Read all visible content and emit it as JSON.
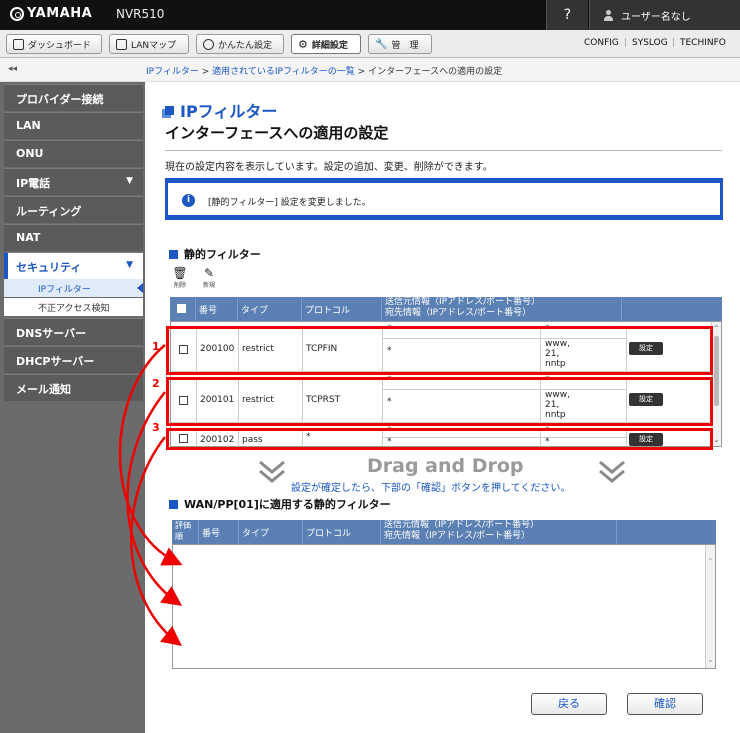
{
  "header": {
    "brand": "YAMAHA",
    "model": "NVR510",
    "help": "?",
    "user": "ユーザー名なし"
  },
  "toolbar": {
    "tabs": [
      {
        "label": "ダッシュボード",
        "icon": "dashboard-icon"
      },
      {
        "label": "LANマップ",
        "icon": "lan-map-icon"
      },
      {
        "label": "かんたん設定",
        "icon": "wizard-icon"
      },
      {
        "label": "詳細設定",
        "icon": "gear-icon",
        "active": true
      },
      {
        "label": "管　理",
        "icon": "wrench-icon"
      }
    ],
    "links": [
      "CONFIG",
      "SYSLOG",
      "TECHINFO"
    ]
  },
  "collapse": "◂◂",
  "breadcrumb": {
    "items": [
      "IPフィルター",
      "適用されているIPフィルターの一覧",
      "インターフェースへの適用の設定"
    ],
    "sep": " > "
  },
  "sidebar": {
    "items": [
      {
        "label": "プロバイダー接続"
      },
      {
        "label": "LAN"
      },
      {
        "label": "ONU"
      },
      {
        "label": "IP電話",
        "arrow": "▼"
      },
      {
        "label": "ルーティング"
      },
      {
        "label": "NAT"
      },
      {
        "label": "セキュリティ",
        "arrow": "▼",
        "selected": true
      },
      {
        "label": "DNSサーバー"
      },
      {
        "label": "DHCPサーバー"
      },
      {
        "label": "メール通知"
      }
    ],
    "subitems": [
      {
        "label": "IPフィルター",
        "selected": true
      },
      {
        "label": "不正アクセス検知"
      }
    ]
  },
  "page": {
    "title": "IPフィルター",
    "subtitle": "インターフェースへの適用の設定",
    "description": "現在の設定内容を表示しています。設定の追加、変更、削除ができます。",
    "message": "[静的フィルター] 設定を変更しました。",
    "message_icon": "i"
  },
  "static_filter": {
    "heading": "静的フィルター",
    "delete_label": "削除",
    "new_label": "新規",
    "columns": {
      "no": "番号",
      "type": "タイプ",
      "protocol": "プロトコル",
      "src": "送信元情報（IPアドレス/ポート番号）",
      "dst": "宛先情報（IPアドレス/ポート番号）"
    },
    "rows": [
      {
        "no": "200100",
        "type": "restrict",
        "protocol": "TCPFIN",
        "src_ip": "*",
        "src_port": "*",
        "dst_ip": "*",
        "dst_port": "www,",
        "dst_port2": "21,",
        "dst_port3": "nntp",
        "btn": "設定"
      },
      {
        "no": "200101",
        "type": "restrict",
        "protocol": "TCPRST",
        "src_ip": "*",
        "src_port": "*",
        "dst_ip": "*",
        "dst_port": "www,",
        "dst_port2": "21,",
        "dst_port3": "nntp",
        "btn": "設定"
      },
      {
        "no": "200102",
        "type": "pass",
        "protocol": "*",
        "src_ip": "*",
        "src_port": "*",
        "dst_ip": "*",
        "dst_port": "*",
        "dst_port2": "",
        "dst_port3": "",
        "btn": "設定"
      }
    ]
  },
  "annotations": {
    "labels": [
      "1",
      "2",
      "3"
    ],
    "color": "#e00000"
  },
  "dnd": {
    "title": "Drag and Drop",
    "hint": "設定が確定したら、下部の「確認」ボタンを押してください。"
  },
  "applied_filter": {
    "heading": "WAN/PP[01]に適用する静的フィルター",
    "columns": {
      "order": "評価順",
      "no": "番号",
      "type": "タイプ",
      "protocol": "プロトコル",
      "src": "送信元情報（IPアドレス/ポート番号）",
      "dst": "宛先情報（IPアドレス/ポート番号）"
    }
  },
  "buttons": {
    "back": "戻る",
    "confirm": "確認"
  },
  "colors": {
    "accent": "#1a56c4",
    "header_bg": "#111111",
    "sidebar_bg": "#6b6b6b",
    "table_header": "#5b80b4"
  }
}
